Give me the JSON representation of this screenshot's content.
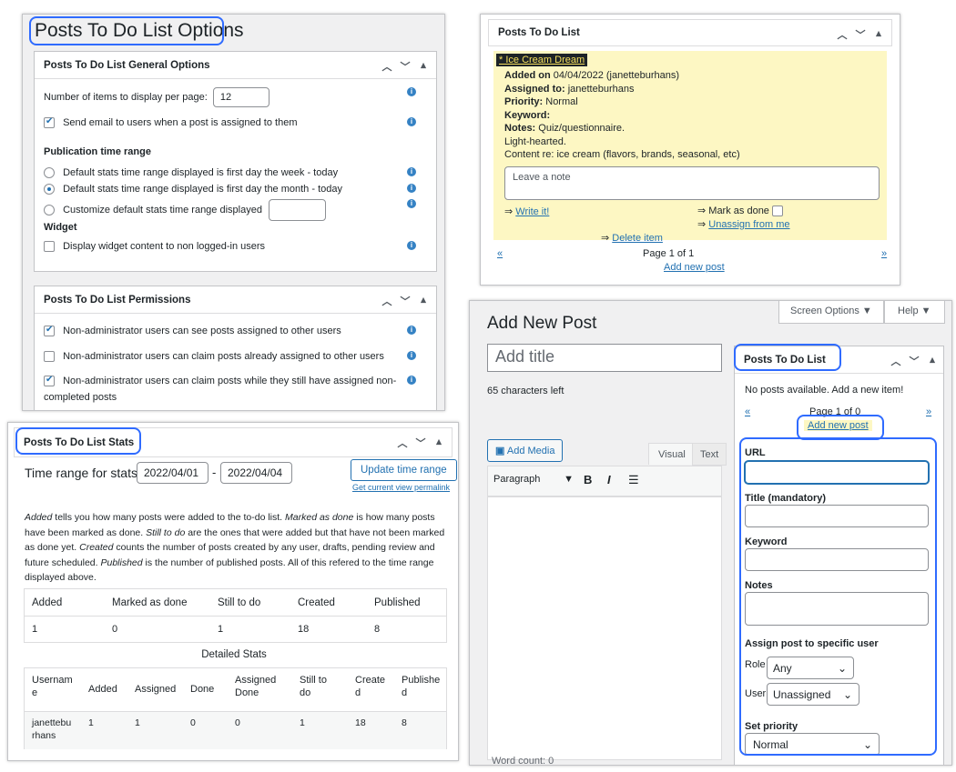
{
  "options_panel": {
    "page_title": "Posts To Do List Options",
    "general": {
      "title": "Posts To Do List General Options",
      "items_per_page_label": "Number of items to display per page:",
      "items_per_page_value": "12",
      "send_email_label": "Send email to users when a post is assigned to them",
      "publication_heading": "Publication time range",
      "range_week": "Default stats time range displayed is first day the week - today",
      "range_month": "Default stats time range displayed is first day the month - today",
      "range_custom": "Customize default stats time range displayed",
      "widget_heading": "Widget",
      "widget_label": "Display widget content to non logged-in users"
    },
    "permissions": {
      "title": "Posts To Do List Permissions",
      "perm1": "Non-administrator users can see posts assigned to other users",
      "perm2": "Non-administrator users can claim posts already assigned to other users",
      "perm3a": "Non-administrator users can claim posts while they still have assigned non-",
      "perm3b": "completed posts"
    }
  },
  "widget_panel": {
    "title": "Posts To Do List",
    "item_title": "* Ice Cream Dream",
    "added_label": "Added on",
    "added_value": "04/04/2022 (janetteburhans)",
    "assigned_label": "Assigned to:",
    "assigned_value": "janetteburhans",
    "priority_label": "Priority:",
    "priority_value": "Normal",
    "keyword_label": "Keyword:",
    "notes_label": "Notes:",
    "notes_value": "Quiz/questionnaire.",
    "notes_line2": "Light-hearted.",
    "notes_line3": "Content re: ice cream (flavors, brands, seasonal, etc)",
    "note_placeholder": "Leave a note",
    "write_it": "Write it!",
    "mark_done": "Mark as done",
    "unassign": "Unassign from me",
    "delete_item": "Delete item",
    "prev": "«",
    "next": "»",
    "page_info": "Page 1 of 1",
    "add_new_post": "Add new post"
  },
  "stats_panel": {
    "title": "Posts To Do List Stats",
    "range_label": "Time range for stats:",
    "from": "2022/04/01",
    "dash": "-",
    "to": "2022/04/04",
    "update_button": "Update time range",
    "permalink": "Get current view permalink",
    "desc1a": "Added",
    "desc1b": " tells you how many posts were added to the to-do list. ",
    "desc1c": "Marked as done",
    "desc1d": " is how many posts",
    "desc2a": "have been marked as done. ",
    "desc2b": "Still to do",
    "desc2c": " are the ones that were added but that have not been marked",
    "desc3a": "as done yet. ",
    "desc3b": "Created",
    "desc3c": " counts the number of posts created by any user, drafts, pending review and",
    "desc4a": "future scheduled. ",
    "desc4b": "Published",
    "desc4c": " is the number of published posts. All of this refered to the time range",
    "desc5": "displayed above.",
    "summary_headers": [
      "Added",
      "Marked as done",
      "Still to do",
      "Created",
      "Published"
    ],
    "summary_values": [
      "1",
      "0",
      "1",
      "18",
      "8"
    ],
    "detailed_title": "Detailed Stats",
    "detail_headers": [
      "Usernam\ne",
      "Added",
      "Assigned",
      "Done",
      "Assigned\nDone",
      "Still to\ndo",
      "Create\nd",
      "Publishe\nd"
    ],
    "detail_row": [
      "janettebu\nrhans",
      "1",
      "1",
      "0",
      "0",
      "1",
      "18",
      "8"
    ]
  },
  "editor_panel": {
    "screen_options": "Screen Options ▼",
    "help": "Help ▼",
    "page_title": "Add New Post",
    "title_placeholder": "Add title",
    "chars_left": "65 characters left",
    "add_media": "Add Media",
    "tab_visual": "Visual",
    "tab_text": "Text",
    "format_select": "Paragraph",
    "bold": "B",
    "italic": "I",
    "word_count": "Word count: 0",
    "metabox": {
      "title": "Posts To Do List",
      "empty": "No posts available. Add a new item!",
      "prev": "«",
      "page_info": "Page 1 of 0",
      "next": "»",
      "add_new_post": "Add new post",
      "url_label": "URL",
      "title_label": "Title (mandatory)",
      "keyword_label": "Keyword",
      "notes_label": "Notes",
      "assign_heading": "Assign post to specific user",
      "role_label": "Role",
      "role_value": "Any",
      "user_label": "User",
      "user_value": "Unassigned",
      "priority_heading": "Set priority",
      "priority_value": "Normal"
    }
  },
  "colors": {
    "highlight_border": "#2f6bff",
    "widget_item_bg": "#fdf7c3",
    "wp_blue": "#2271b1"
  }
}
